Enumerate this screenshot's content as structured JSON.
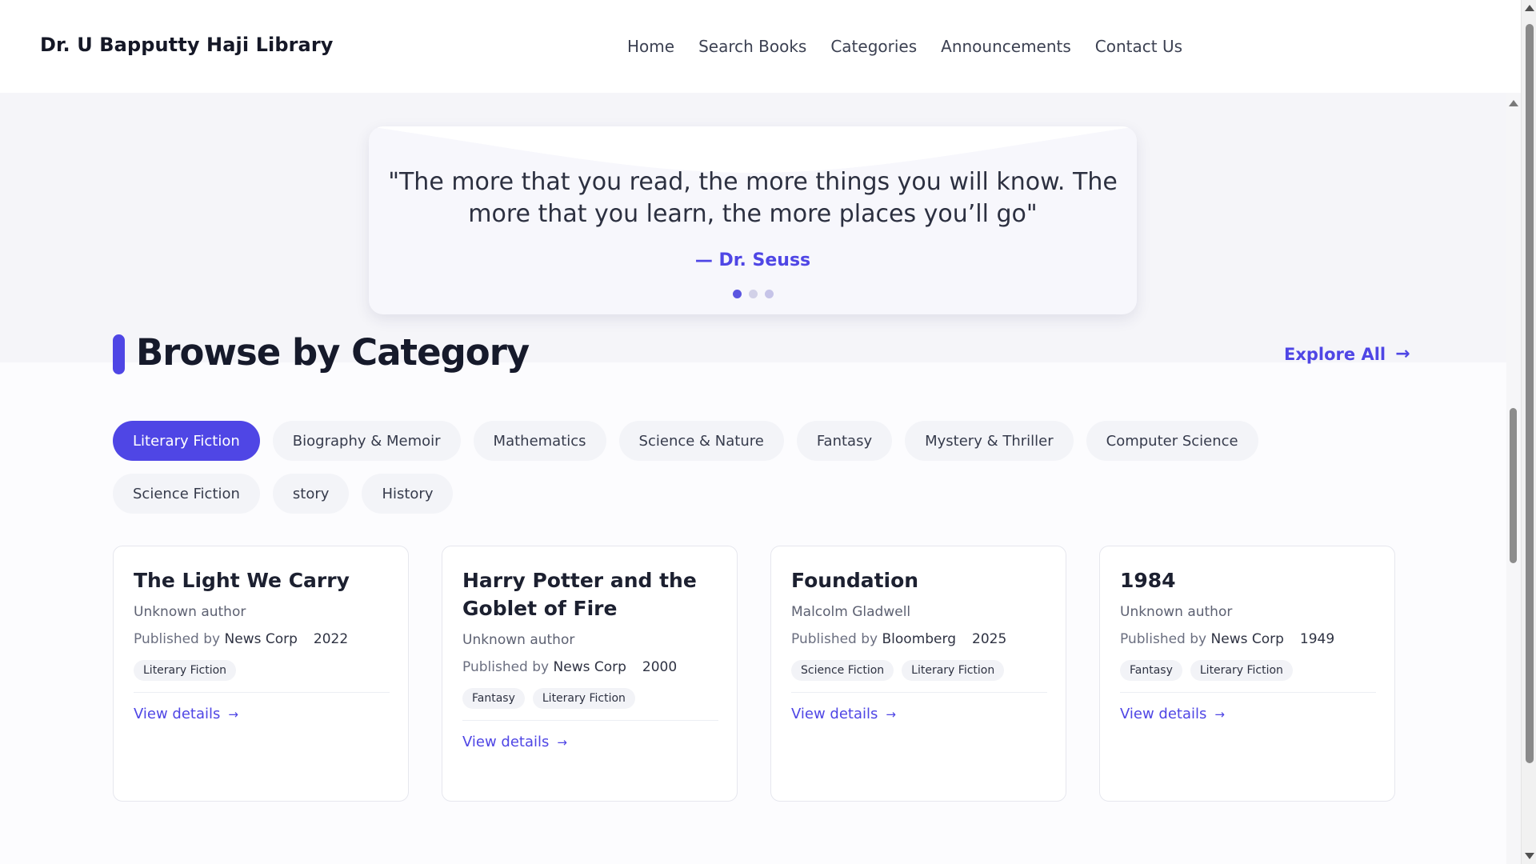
{
  "brand": "Dr. U Bapputty Haji Library",
  "nav": [
    "Home",
    "Search Books",
    "Categories",
    "Announcements",
    "Contact Us"
  ],
  "quote": {
    "text": "\"The more that you read, the more things you will know. The more that you learn, the more places you’ll go\"",
    "author": "— Dr. Seuss",
    "active_slide": 1,
    "slide_count": 3
  },
  "section": {
    "title": "Browse by Category",
    "explore_label": "Explore All"
  },
  "categories": [
    {
      "label": "Literary Fiction",
      "active": true
    },
    {
      "label": "Biography & Memoir"
    },
    {
      "label": "Mathematics"
    },
    {
      "label": "Science & Nature"
    },
    {
      "label": "Fantasy"
    },
    {
      "label": "Mystery & Thriller"
    },
    {
      "label": "Computer Science"
    },
    {
      "label": "Science Fiction"
    },
    {
      "label": "story"
    },
    {
      "label": "History"
    }
  ],
  "books": [
    {
      "title": "The Light We Carry",
      "author": "Unknown author",
      "published_by_label": "Published by",
      "publisher": "News Corp",
      "year": "2022",
      "tags": [
        "Literary Fiction"
      ],
      "link_label": "View details"
    },
    {
      "title": "Harry Potter and the Goblet of Fire",
      "author": "Unknown author",
      "published_by_label": "Published by",
      "publisher": "News Corp",
      "year": "2000",
      "tags": [
        "Fantasy",
        "Literary Fiction"
      ],
      "link_label": "View details"
    },
    {
      "title": "Foundation",
      "author": "Malcolm Gladwell",
      "published_by_label": "Published by",
      "publisher": "Bloomberg",
      "year": "2025",
      "tags": [
        "Science Fiction",
        "Literary Fiction"
      ],
      "link_label": "View details"
    },
    {
      "title": "1984",
      "author": "Unknown author",
      "published_by_label": "Published by",
      "publisher": "News Corp",
      "year": "1949",
      "tags": [
        "Fantasy",
        "Literary Fiction"
      ],
      "link_label": "View details"
    }
  ],
  "colors": {
    "accent": "#4f46e5",
    "chip_bg": "#f3f4f8",
    "quote_band_bg": "#f5f5f9"
  },
  "icons": {
    "explore_arrow": "arrow-right-icon",
    "view_details_arrow": "arrow-right-icon"
  }
}
